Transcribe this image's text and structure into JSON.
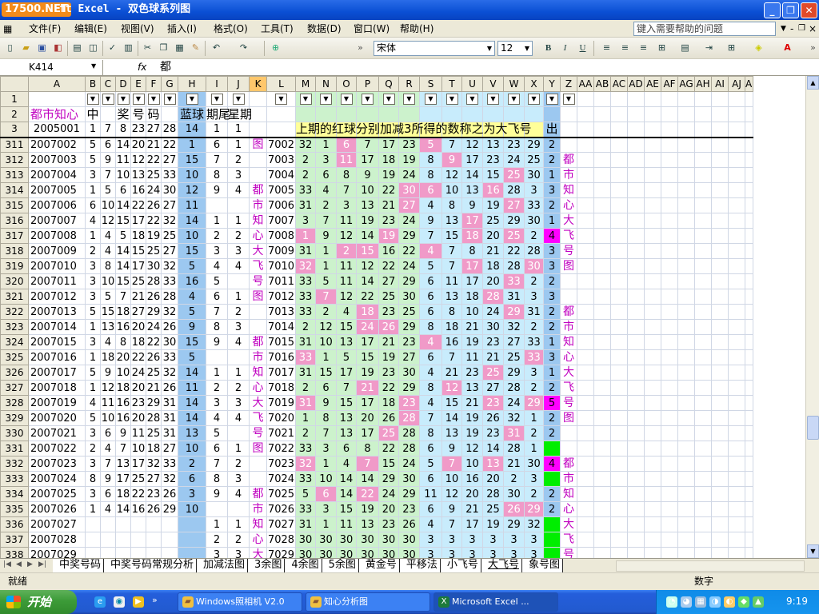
{
  "window": {
    "title": "ft Excel - 双色球系列图",
    "logo": "17500.NET"
  },
  "menu": {
    "items": [
      "文件(F)",
      "编辑(E)",
      "视图(V)",
      "插入(I)",
      "格式(O)",
      "工具(T)",
      "数据(D)",
      "窗口(W)",
      "帮助(H)"
    ],
    "help_placeholder": "键入需要帮助的问题"
  },
  "toolbar": {
    "font_name": "宋体",
    "font_size": "12"
  },
  "formula_bar": {
    "name_box": "K414",
    "fx": "fx",
    "value": "都"
  },
  "columns": [
    "A",
    "B",
    "C",
    "D",
    "E",
    "F",
    "G",
    "H",
    "I",
    "J",
    "K",
    "L",
    "M",
    "N",
    "O",
    "P",
    "Q",
    "R",
    "S",
    "T",
    "U",
    "V",
    "W",
    "X",
    "Y",
    "Z",
    "AA",
    "AB",
    "AC",
    "AD",
    "AE",
    "AF",
    "AG",
    "AH",
    "AI",
    "AJ",
    "AK",
    "AL"
  ],
  "header_rows": {
    "r2": {
      "A": "都市知心",
      "B": "中",
      "D": "奖",
      "E": "号",
      "F": "码",
      "H": "蓝球",
      "I": "期尾",
      "J": "星期"
    },
    "r3": {
      "A": "2005001",
      "B": "1",
      "C": "7",
      "D": "8",
      "E": "23",
      "F": "27",
      "G": "28",
      "H": "14",
      "I": "1",
      "J": "1",
      "banner": "上期的红球分别加减3所得的数称之为大飞号",
      "Y": "出"
    }
  },
  "rows": [
    {
      "n": "311",
      "a": "2007002",
      "r": [
        5,
        6,
        14,
        20,
        21,
        22
      ],
      "h": "1",
      "i": "6",
      "j": "1",
      "k": "图",
      "l": "7002",
      "m": [
        32,
        1,
        6,
        7,
        17,
        23,
        5,
        7,
        12,
        13,
        23,
        29
      ],
      "y": "2",
      "z": "",
      "p": [
        2,
        6
      ]
    },
    {
      "n": "312",
      "a": "2007003",
      "r": [
        5,
        9,
        11,
        12,
        22,
        27
      ],
      "h": "15",
      "i": "7",
      "j": "2",
      "k": "",
      "l": "7003",
      "m": [
        2,
        3,
        11,
        17,
        18,
        19,
        8,
        9,
        17,
        23,
        24,
        25
      ],
      "y": "2",
      "z": "都",
      "p": [
        2,
        7
      ]
    },
    {
      "n": "313",
      "a": "2007004",
      "r": [
        3,
        7,
        10,
        13,
        25,
        33
      ],
      "h": "10",
      "i": "8",
      "j": "3",
      "k": "",
      "l": "7004",
      "m": [
        2,
        6,
        8,
        9,
        19,
        24,
        8,
        12,
        14,
        15,
        25,
        30
      ],
      "y": "1",
      "z": "市",
      "p": [
        10
      ]
    },
    {
      "n": "314",
      "a": "2007005",
      "r": [
        1,
        5,
        6,
        16,
        24,
        30
      ],
      "h": "12",
      "i": "9",
      "j": "4",
      "k": "都",
      "l": "7005",
      "m": [
        33,
        4,
        7,
        10,
        22,
        30,
        6,
        10,
        13,
        16,
        28,
        3
      ],
      "y": "3",
      "z": "知",
      "p": [
        5,
        6,
        9
      ]
    },
    {
      "n": "315",
      "a": "2007006",
      "r": [
        6,
        10,
        14,
        22,
        26,
        27
      ],
      "h": "11",
      "i": "",
      "j": "",
      "k": "市",
      "l": "7006",
      "m": [
        31,
        2,
        3,
        13,
        21,
        27,
        4,
        8,
        9,
        19,
        27,
        33
      ],
      "y": "2",
      "z": "心",
      "p": [
        5,
        10
      ]
    },
    {
      "n": "316",
      "a": "2007007",
      "r": [
        4,
        12,
        15,
        17,
        22,
        32
      ],
      "h": "14",
      "i": "1",
      "j": "1",
      "k": "知",
      "l": "7007",
      "m": [
        3,
        7,
        11,
        19,
        23,
        24,
        9,
        13,
        17,
        25,
        29,
        30
      ],
      "y": "1",
      "z": "大",
      "p": [
        8
      ]
    },
    {
      "n": "317",
      "a": "2007008",
      "r": [
        1,
        4,
        5,
        18,
        19,
        25
      ],
      "h": "10",
      "i": "2",
      "j": "2",
      "k": "心",
      "l": "7008",
      "m": [
        1,
        9,
        12,
        14,
        19,
        29,
        7,
        15,
        18,
        20,
        25,
        2
      ],
      "y": "4",
      "z": "飞",
      "p": [
        0,
        4,
        8,
        10
      ],
      "ym": true
    },
    {
      "n": "318",
      "a": "2007009",
      "r": [
        2,
        4,
        14,
        15,
        25,
        27
      ],
      "h": "15",
      "i": "3",
      "j": "3",
      "k": "大",
      "l": "7009",
      "m": [
        31,
        1,
        2,
        15,
        16,
        22,
        4,
        7,
        8,
        21,
        22,
        28
      ],
      "y": "3",
      "z": "号",
      "p": [
        2,
        3,
        6
      ]
    },
    {
      "n": "319",
      "a": "2007010",
      "r": [
        3,
        8,
        14,
        17,
        30,
        32
      ],
      "h": "5",
      "i": "4",
      "j": "4",
      "k": "飞",
      "l": "7010",
      "m": [
        32,
        1,
        11,
        12,
        22,
        24,
        5,
        7,
        17,
        18,
        28,
        30
      ],
      "y": "3",
      "z": "图",
      "p": [
        0,
        8,
        11
      ]
    },
    {
      "n": "320",
      "a": "2007011",
      "r": [
        3,
        10,
        15,
        25,
        28,
        33
      ],
      "h": "16",
      "i": "5",
      "j": "",
      "k": "号",
      "l": "7011",
      "m": [
        33,
        5,
        11,
        14,
        27,
        29,
        6,
        11,
        17,
        20,
        33,
        2
      ],
      "y": "2",
      "z": "",
      "p": [
        10
      ]
    },
    {
      "n": "321",
      "a": "2007012",
      "r": [
        3,
        5,
        7,
        21,
        26,
        28
      ],
      "h": "4",
      "i": "6",
      "j": "1",
      "k": "图",
      "l": "7012",
      "m": [
        33,
        7,
        12,
        22,
        25,
        30,
        6,
        13,
        18,
        28,
        31,
        3
      ],
      "y": "3",
      "z": "",
      "p": [
        1,
        9
      ]
    },
    {
      "n": "322",
      "a": "2007013",
      "r": [
        5,
        15,
        18,
        27,
        29,
        32
      ],
      "h": "5",
      "i": "7",
      "j": "2",
      "k": "",
      "l": "7013",
      "m": [
        33,
        2,
        4,
        18,
        23,
        25,
        6,
        8,
        10,
        24,
        29,
        31
      ],
      "y": "2",
      "z": "都",
      "p": [
        3,
        10
      ]
    },
    {
      "n": "323",
      "a": "2007014",
      "r": [
        1,
        13,
        16,
        20,
        24,
        26
      ],
      "h": "9",
      "i": "8",
      "j": "3",
      "k": "",
      "l": "7014",
      "m": [
        2,
        12,
        15,
        24,
        26,
        29,
        8,
        18,
        21,
        30,
        32,
        2
      ],
      "y": "2",
      "z": "市",
      "p": [
        3,
        4
      ]
    },
    {
      "n": "324",
      "a": "2007015",
      "r": [
        3,
        4,
        8,
        18,
        22,
        30
      ],
      "h": "15",
      "i": "9",
      "j": "4",
      "k": "都",
      "l": "7015",
      "m": [
        31,
        10,
        13,
        17,
        21,
        23,
        4,
        16,
        19,
        23,
        27,
        33
      ],
      "y": "1",
      "z": "知",
      "p": [
        6
      ]
    },
    {
      "n": "325",
      "a": "2007016",
      "r": [
        1,
        18,
        20,
        22,
        26,
        33
      ],
      "h": "5",
      "i": "",
      "j": "",
      "k": "市",
      "l": "7016",
      "m": [
        33,
        1,
        5,
        15,
        19,
        27,
        6,
        7,
        11,
        21,
        25,
        33
      ],
      "y": "3",
      "z": "心",
      "p": [
        0,
        11
      ]
    },
    {
      "n": "326",
      "a": "2007017",
      "r": [
        5,
        9,
        10,
        24,
        25,
        32
      ],
      "h": "14",
      "i": "1",
      "j": "1",
      "k": "知",
      "l": "7017",
      "m": [
        31,
        15,
        17,
        19,
        23,
        30,
        4,
        21,
        23,
        25,
        29,
        3
      ],
      "y": "1",
      "z": "大",
      "p": [
        9
      ]
    },
    {
      "n": "327",
      "a": "2007018",
      "r": [
        1,
        12,
        18,
        20,
        21,
        26
      ],
      "h": "11",
      "i": "2",
      "j": "2",
      "k": "心",
      "l": "7018",
      "m": [
        2,
        6,
        7,
        21,
        22,
        29,
        8,
        12,
        13,
        27,
        28,
        2
      ],
      "y": "2",
      "z": "飞",
      "p": [
        3,
        7
      ]
    },
    {
      "n": "328",
      "a": "2007019",
      "r": [
        4,
        11,
        16,
        23,
        29,
        31
      ],
      "h": "14",
      "i": "3",
      "j": "3",
      "k": "大",
      "l": "7019",
      "m": [
        31,
        9,
        15,
        17,
        18,
        23,
        4,
        15,
        21,
        23,
        24,
        29
      ],
      "y": "5",
      "z": "号",
      "p": [
        0,
        5,
        9,
        11
      ],
      "ym": true
    },
    {
      "n": "329",
      "a": "2007020",
      "r": [
        5,
        10,
        16,
        20,
        28,
        31
      ],
      "h": "14",
      "i": "4",
      "j": "4",
      "k": "飞",
      "l": "7020",
      "m": [
        1,
        8,
        13,
        20,
        26,
        28,
        7,
        14,
        19,
        26,
        32,
        1
      ],
      "y": "2",
      "z": "图",
      "p": [
        5
      ]
    },
    {
      "n": "330",
      "a": "2007021",
      "r": [
        3,
        6,
        9,
        11,
        25,
        31
      ],
      "h": "13",
      "i": "5",
      "j": "",
      "k": "号",
      "l": "7021",
      "m": [
        2,
        7,
        13,
        17,
        25,
        28,
        8,
        13,
        19,
        23,
        31,
        2
      ],
      "y": "2",
      "z": "",
      "p": [
        4,
        10
      ]
    },
    {
      "n": "331",
      "a": "2007022",
      "r": [
        2,
        4,
        7,
        10,
        18,
        27
      ],
      "h": "10",
      "i": "6",
      "j": "1",
      "k": "图",
      "l": "7022",
      "m": [
        33,
        3,
        6,
        8,
        22,
        28,
        6,
        9,
        12,
        14,
        28,
        1
      ],
      "y": "",
      "z": "",
      "p": [],
      "yg": true
    },
    {
      "n": "332",
      "a": "2007023",
      "r": [
        3,
        7,
        13,
        17,
        32,
        33
      ],
      "h": "2",
      "i": "7",
      "j": "2",
      "k": "",
      "l": "7023",
      "m": [
        32,
        1,
        4,
        7,
        15,
        24,
        5,
        7,
        10,
        13,
        21,
        30
      ],
      "y": "4",
      "z": "都",
      "p": [
        0,
        3,
        7,
        9
      ],
      "ym": true
    },
    {
      "n": "333",
      "a": "2007024",
      "r": [
        8,
        9,
        17,
        25,
        27,
        32
      ],
      "h": "6",
      "i": "8",
      "j": "3",
      "k": "",
      "l": "7024",
      "m": [
        33,
        10,
        14,
        14,
        29,
        30,
        6,
        10,
        16,
        20,
        2,
        3
      ],
      "y": "",
      "z": "市",
      "p": [],
      "yg": true
    },
    {
      "n": "334",
      "a": "2007025",
      "r": [
        3,
        6,
        18,
        22,
        23,
        26
      ],
      "h": "3",
      "i": "9",
      "j": "4",
      "k": "都",
      "l": "7025",
      "m": [
        5,
        6,
        14,
        22,
        24,
        29,
        11,
        12,
        20,
        28,
        30,
        2
      ],
      "y": "2",
      "z": "知",
      "p": [
        1,
        3
      ]
    },
    {
      "n": "335",
      "a": "2007026",
      "r": [
        1,
        4,
        14,
        16,
        26,
        29
      ],
      "h": "10",
      "i": "",
      "j": "",
      "k": "市",
      "l": "7026",
      "m": [
        33,
        3,
        15,
        19,
        20,
        23,
        6,
        9,
        21,
        25,
        26,
        29
      ],
      "y": "2",
      "z": "心",
      "p": [
        10,
        11
      ]
    },
    {
      "n": "336",
      "a": "2007027",
      "r": [],
      "h": "",
      "i": "1",
      "j": "1",
      "k": "知",
      "l": "7027",
      "m": [
        31,
        1,
        11,
        13,
        23,
        26,
        4,
        7,
        17,
        19,
        29,
        32
      ],
      "y": "",
      "z": "大",
      "p": [],
      "yg": true
    },
    {
      "n": "337",
      "a": "2007028",
      "r": [],
      "h": "",
      "i": "2",
      "j": "2",
      "k": "心",
      "l": "7028",
      "m": [
        30,
        30,
        30,
        30,
        30,
        30,
        3,
        3,
        3,
        3,
        3,
        3
      ],
      "y": "",
      "z": "飞",
      "p": [],
      "yg": true
    },
    {
      "n": "338",
      "a": "2007029",
      "r": [],
      "h": "",
      "i": "3",
      "j": "3",
      "k": "大",
      "l": "7029",
      "m": [
        30,
        30,
        30,
        30,
        30,
        30,
        3,
        3,
        3,
        3,
        3,
        3
      ],
      "y": "",
      "z": "号",
      "p": [],
      "yg": true
    }
  ],
  "sheet_tabs": [
    "中奖号码",
    "中奖号码常规分析",
    "加减法图",
    "3余图",
    "4余图",
    "5余图",
    "黄金号",
    "平移法",
    "小飞号",
    "大飞号",
    "象号图"
  ],
  "status": {
    "left": "就绪",
    "right": "数字"
  },
  "taskbar": {
    "start": "开始",
    "tasks": [
      "Windows照相机 V2.0",
      "知心分析图",
      "Microsoft Excel ..."
    ],
    "clock": "9:19"
  },
  "colors": {
    "blue_col": "#9cc8f0",
    "green_col": "#ccf2cc",
    "cyan_col": "#c8ecfc",
    "pink_cell": "#f09ac8",
    "magenta_cell": "#ff00ff",
    "green_cell": "#00ee00",
    "purple_text": "#c000c0"
  }
}
